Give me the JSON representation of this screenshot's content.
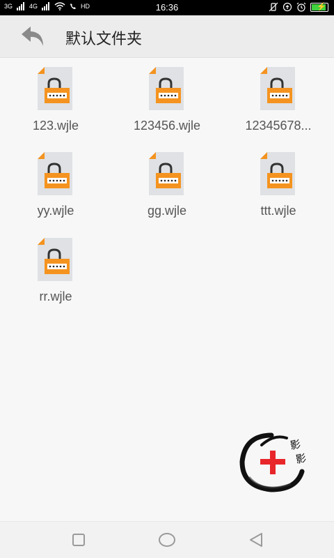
{
  "status": {
    "time": "16:36",
    "left_labels": [
      "3G",
      "4G",
      "HD"
    ],
    "battery_level": 0.85
  },
  "toolbar": {
    "title": "默认文件夹",
    "back_icon": "back-arrow-icon"
  },
  "files": [
    {
      "name": "123.wjle",
      "icon": "locked-file-icon"
    },
    {
      "name": "123456.wjle",
      "icon": "locked-file-icon"
    },
    {
      "name": "12345678...",
      "icon": "locked-file-icon"
    },
    {
      "name": "yy.wjle",
      "icon": "locked-file-icon"
    },
    {
      "name": "gg.wjle",
      "icon": "locked-file-icon"
    },
    {
      "name": "ttt.wjle",
      "icon": "locked-file-icon"
    },
    {
      "name": "rr.wjle",
      "icon": "locked-file-icon"
    }
  ],
  "fab": {
    "icon": "add-plus-icon",
    "logo_text": "影影"
  },
  "colors": {
    "lock_orange": "#f4931f",
    "fab_red": "#e8262a",
    "doc_gray": "#dfe1e4"
  }
}
